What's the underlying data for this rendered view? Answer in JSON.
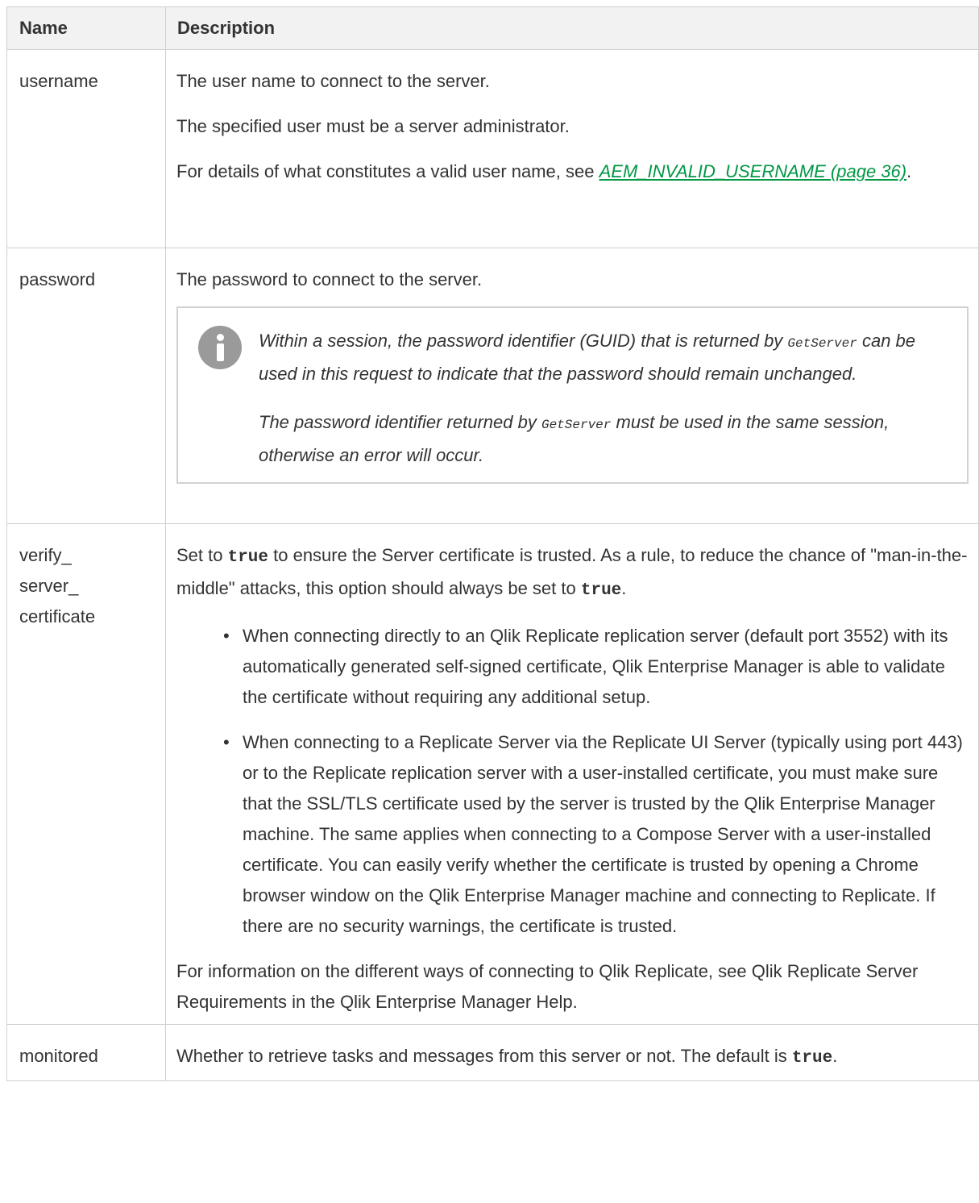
{
  "table": {
    "headers": {
      "name": "Name",
      "description": "Description"
    },
    "rows": [
      {
        "name": "username",
        "desc": {
          "p1": "The user name to connect to the server.",
          "p2": "The specified user must be a server administrator.",
          "p3_prefix": "For details of what constitutes a valid user name, see ",
          "p3_link": "AEM_INVALID_USERNAME (page 36)",
          "p3_suffix": "."
        }
      },
      {
        "name": "password",
        "desc": {
          "p1": "The password to connect to the server.",
          "note": {
            "icon": "info-icon",
            "n1_prefix": "Within a session, the password identifier (GUID) that is returned by ",
            "n1_code": "GetServer",
            "n1_suffix": " can be used in this request to indicate that the password should remain unchanged.",
            "n2_prefix": "The password identifier returned by ",
            "n2_code": "GetServer",
            "n2_suffix": " must be used in the same session, otherwise an error will occur."
          }
        }
      },
      {
        "name_parts": [
          "verify_",
          "server_",
          "certificate"
        ],
        "desc": {
          "p1_prefix": "Set to ",
          "p1_code1": "true",
          "p1_middle": " to ensure the Server certificate is trusted. As a rule, to reduce the chance of \"man-in-the-middle\" attacks, this option should always be set to ",
          "p1_code2": "true",
          "p1_suffix": ".",
          "bullets": [
            "When connecting directly to an Qlik Replicate replication server (default port 3552) with its automatically generated self-signed certificate, Qlik Enterprise Manager is able to validate the certificate without requiring any additional setup.",
            "When connecting to a Replicate Server via the Replicate UI Server (typically using port 443) or to the Replicate replication server with a user-installed certificate, you must make sure that the SSL/TLS certificate used by the server is trusted by the Qlik Enterprise Manager machine. The same applies when connecting to a Compose Server with a user-installed certificate. You can easily verify whether the certificate is trusted by opening a Chrome browser window on the Qlik Enterprise Manager machine and connecting to Replicate. If there are no security warnings, the certificate is trusted."
          ],
          "p_last": "For information on the different ways of connecting to Qlik Replicate, see Qlik Replicate Server Requirements in the Qlik Enterprise Manager Help."
        }
      },
      {
        "name": "monitored",
        "desc": {
          "p1_prefix": "Whether to retrieve tasks and messages from this server or not. The default is ",
          "p1_code": "true",
          "p1_suffix": "."
        }
      }
    ]
  }
}
